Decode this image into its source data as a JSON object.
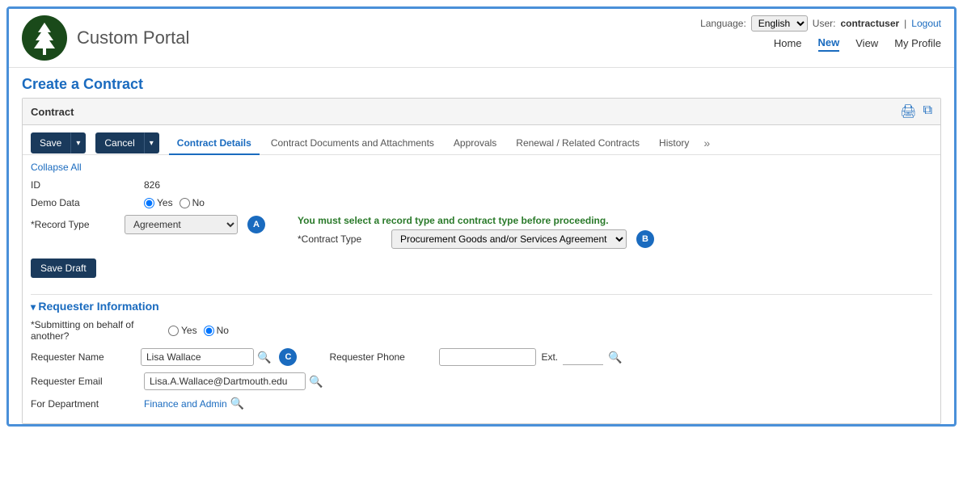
{
  "app": {
    "title": "Custom Portal",
    "lang_label": "Language:",
    "lang_value": "English",
    "user_label": "User:",
    "username": "contractuser",
    "logout": "Logout"
  },
  "nav": {
    "home": "Home",
    "new": "New",
    "view": "View",
    "my_profile": "My Profile"
  },
  "page": {
    "title": "Create a Contract"
  },
  "contract_section": {
    "label": "Contract"
  },
  "buttons": {
    "save": "Save",
    "cancel": "Cancel",
    "save_draft": "Save Draft"
  },
  "tabs": [
    {
      "label": "Contract Details",
      "active": true
    },
    {
      "label": "Contract Documents and Attachments",
      "active": false
    },
    {
      "label": "Approvals",
      "active": false
    },
    {
      "label": "Renewal / Related Contracts",
      "active": false
    },
    {
      "label": "History",
      "active": false
    }
  ],
  "collapse_all": "Collapse All",
  "form": {
    "id_label": "ID",
    "id_value": "826",
    "demo_data_label": "Demo Data",
    "record_type_label": "*Record Type",
    "record_type_value": "Agreement",
    "warning_text": "You must select a record type and contract type before proceeding.",
    "contract_type_label": "*Contract Type",
    "contract_type_value": "Procurement Goods and/or Services Agreement",
    "badge_a": "A",
    "badge_b": "B",
    "badge_c": "C"
  },
  "requester": {
    "section_title": "Requester Information",
    "submitting_label": "*Submitting on behalf of another?",
    "requester_name_label": "Requester Name",
    "requester_name_value": "Lisa Wallace",
    "requester_phone_label": "Requester Phone",
    "ext_label": "Ext.",
    "requester_email_label": "Requester Email",
    "requester_email_value": "Lisa.A.Wallace@Dartmouth.edu",
    "for_dept_label": "For Department",
    "for_dept_value": "Finance and Admin"
  }
}
